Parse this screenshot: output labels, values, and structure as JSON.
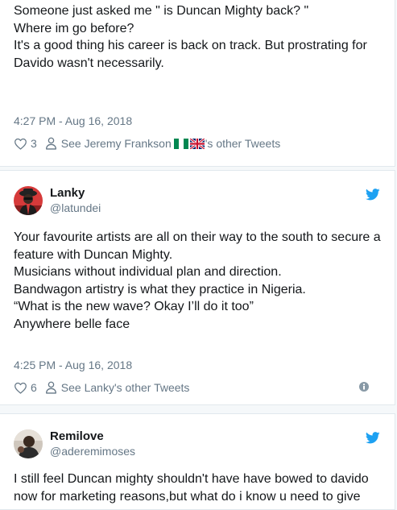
{
  "tweets": [
    {
      "text_lines": [
        "Someone just asked me \" is Duncan Mighty back? \"",
        "",
        "Where im go before?",
        "",
        "It's a good thing his career is back on track. But prostrating for Davido wasn't necessarily."
      ],
      "timestamp": "4:27 PM - Aug 16, 2018",
      "likes": "3",
      "see_other_prefix": "See Jeremy Frankson",
      "see_other_suffix": "'s other Tweets"
    },
    {
      "author_name": "Lanky",
      "author_handle": "@latundei",
      "text_lines": [
        "Your favourite artists are all on their way to the south to secure a feature with Duncan Mighty.",
        "Musicians without individual plan and direction.",
        "Bandwagon artistry is what they practice in Nigeria.",
        "",
        "“What is the new wave? Okay I’ll do it too”",
        "Anywhere belle face"
      ],
      "timestamp": "4:25 PM - Aug 16, 2018",
      "likes": "6",
      "see_other": "See Lanky's other Tweets"
    },
    {
      "author_name": "Remilove",
      "author_handle": "@aderemimoses",
      "text_lines": [
        "I still feel Duncan mighty shouldn't have have bowed to davido now for marketing reasons,but what do i know u need to give"
      ]
    }
  ],
  "icons": {
    "like": "heart-outline-icon",
    "profile": "person-outline-icon",
    "brand": "twitter-bird-icon",
    "info": "info-circle-icon",
    "flag_1": "nigeria-flag-icon",
    "flag_2": "uk-flag-icon"
  },
  "colors": {
    "twitter_blue": "#1da1f2",
    "secondary_text": "#657786",
    "divider": "#e1e8ed"
  }
}
